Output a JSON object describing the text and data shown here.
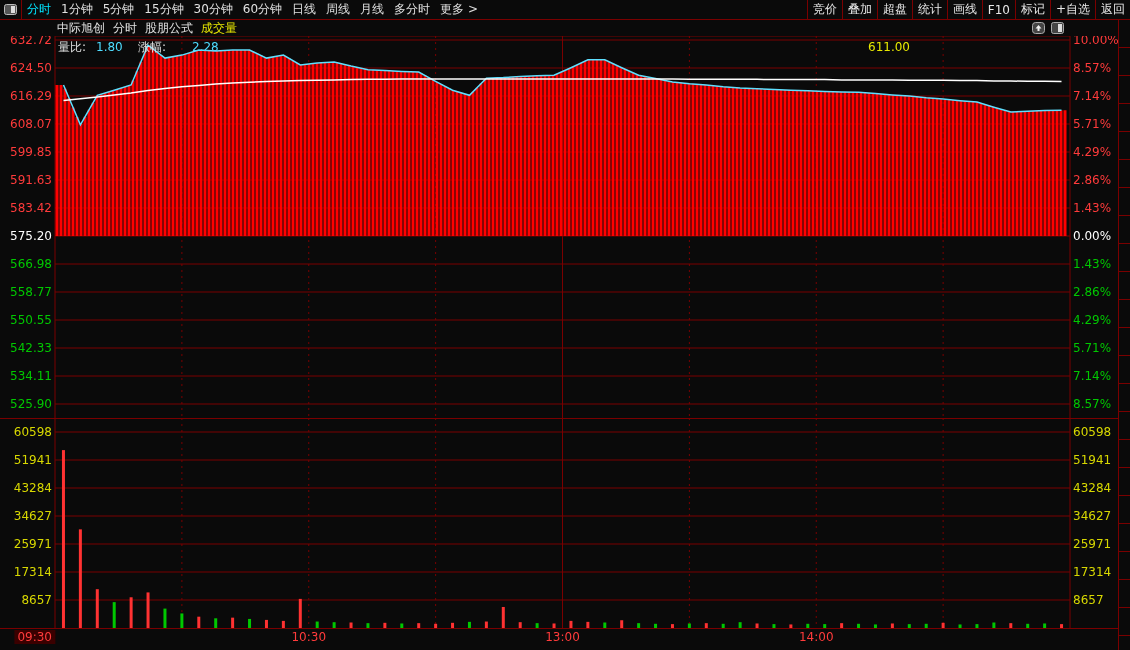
{
  "tabs": [
    {
      "label": "分时",
      "selected": true
    },
    {
      "label": "1分钟",
      "selected": false
    },
    {
      "label": "5分钟",
      "selected": false
    },
    {
      "label": "15分钟",
      "selected": false
    },
    {
      "label": "30分钟",
      "selected": false
    },
    {
      "label": "60分钟",
      "selected": false
    },
    {
      "label": "日线",
      "selected": false
    },
    {
      "label": "周线",
      "selected": false
    },
    {
      "label": "月线",
      "selected": false
    },
    {
      "label": "多分时",
      "selected": false
    },
    {
      "label": "更多 >",
      "selected": false
    }
  ],
  "toolbar_buttons": [
    "竞价",
    "叠加",
    "超盘",
    "统计",
    "画线",
    "F10",
    "标记",
    "+自选",
    "返回"
  ],
  "header": {
    "stock": "中际旭创",
    "mode": "分时",
    "formula": "股朋公式",
    "indicator": "成交量"
  },
  "info": {
    "ratio_label": "量比:",
    "ratio_value": "1.80",
    "change_label": "涨幅:",
    "change_value": "2.28",
    "marker_price": "611.00"
  },
  "price_chart": {
    "chart_data": {
      "type": "line",
      "grid": true,
      "ylim": [
        525.9,
        632.72
      ],
      "yticks": [
        {
          "value": 632.72,
          "label": "632.72"
        },
        {
          "value": 624.5,
          "label": "624.50"
        },
        {
          "value": 616.29,
          "label": "616.29"
        },
        {
          "value": 608.07,
          "label": "608.07"
        },
        {
          "value": 599.85,
          "label": "599.85"
        },
        {
          "value": 591.63,
          "label": "591.63"
        },
        {
          "value": 583.42,
          "label": "583.42"
        },
        {
          "value": 575.2,
          "label": "575.20"
        },
        {
          "value": 566.98,
          "label": "566.98"
        },
        {
          "value": 558.77,
          "label": "558.77"
        },
        {
          "value": 550.55,
          "label": "550.55"
        },
        {
          "value": 542.33,
          "label": "542.33"
        },
        {
          "value": 534.11,
          "label": "534.11"
        },
        {
          "value": 525.9,
          "label": "525.90"
        }
      ],
      "series": [
        {
          "color": "#5ee0ff",
          "values": [
            619.5,
            607.8,
            616.5,
            618.0,
            619.5,
            631.2,
            627.4,
            628.3,
            629.8,
            629.5,
            629.8,
            629.8,
            627.4,
            628.3,
            625.4,
            626.0,
            626.3,
            625.1,
            624.0,
            623.8,
            623.5,
            623.3,
            620.6,
            618.0,
            616.5,
            621.5,
            621.7,
            622.0,
            622.2,
            622.4,
            624.6,
            626.9,
            626.9,
            624.6,
            622.4,
            621.4,
            620.4,
            619.9,
            619.5,
            619.0,
            618.6,
            618.4,
            618.2,
            618.0,
            617.8,
            617.6,
            617.5,
            617.4,
            617.0,
            616.6,
            616.3,
            615.8,
            615.4,
            614.9,
            614.5,
            613.0,
            611.6,
            611.8,
            612.0,
            612.1
          ]
        },
        {
          "color": "#ffffff",
          "values": [
            615.0,
            615.5,
            616.0,
            616.6,
            617.2,
            617.9,
            618.5,
            619.0,
            619.4,
            619.8,
            620.1,
            620.3,
            620.5,
            620.7,
            620.8,
            620.9,
            621.0,
            621.1,
            621.2,
            621.2,
            621.3,
            621.3,
            621.3,
            621.3,
            621.3,
            621.3,
            621.3,
            621.3,
            621.3,
            621.3,
            621.3,
            621.3,
            621.3,
            621.3,
            621.3,
            621.3,
            621.3,
            621.2,
            621.2,
            621.2,
            621.2,
            621.2,
            621.1,
            621.1,
            621.1,
            621.1,
            621.0,
            621.0,
            621.0,
            621.0,
            620.9,
            620.9,
            620.9,
            620.8,
            620.8,
            620.7,
            620.7,
            620.6,
            620.6,
            620.5
          ]
        }
      ]
    },
    "right_axis": [
      {
        "text": "10.00%",
        "kind": "up"
      },
      {
        "text": "8.57%",
        "kind": "up"
      },
      {
        "text": "7.14%",
        "kind": "up"
      },
      {
        "text": "5.71%",
        "kind": "up"
      },
      {
        "text": "4.29%",
        "kind": "up"
      },
      {
        "text": "2.86%",
        "kind": "up"
      },
      {
        "text": "1.43%",
        "kind": "up"
      },
      {
        "text": "0.00%",
        "kind": "flat"
      },
      {
        "text": "1.43%",
        "kind": "down"
      },
      {
        "text": "2.86%",
        "kind": "down"
      },
      {
        "text": "4.29%",
        "kind": "down"
      },
      {
        "text": "5.71%",
        "kind": "down"
      },
      {
        "text": "7.14%",
        "kind": "down"
      },
      {
        "text": "8.57%",
        "kind": "down"
      }
    ]
  },
  "volume_chart": {
    "chart_data": {
      "type": "bar",
      "grid": true,
      "ylim": [
        0,
        60598
      ],
      "yticks": [
        {
          "value": 60598,
          "label": "60598"
        },
        {
          "value": 51941,
          "label": "51941"
        },
        {
          "value": 43284,
          "label": "43284"
        },
        {
          "value": 34627,
          "label": "34627"
        },
        {
          "value": 25971,
          "label": "25971"
        },
        {
          "value": 17314,
          "label": "17314"
        },
        {
          "value": 8657,
          "label": "8657"
        }
      ],
      "series": [
        {
          "color": "#ff3232",
          "values": [
            55000,
            30500,
            12000,
            null,
            9500,
            11000,
            null,
            null,
            3500,
            null,
            3200,
            null,
            2500,
            2200,
            9000,
            null,
            null,
            1700,
            null,
            1600,
            null,
            1500,
            1300,
            1600,
            null,
            2000,
            6500,
            1800,
            null,
            1400,
            2200,
            1900,
            null,
            2400,
            null,
            null,
            1200,
            null,
            1500,
            null,
            null,
            1400,
            null,
            1100,
            null,
            null,
            1500,
            null,
            null,
            1400,
            null,
            null,
            1600,
            null,
            null,
            null,
            1500,
            null,
            null,
            1200
          ]
        },
        {
          "color": "#00c800",
          "values": [
            null,
            null,
            null,
            8000,
            null,
            null,
            6000,
            4500,
            null,
            3000,
            null,
            2800,
            null,
            null,
            null,
            2000,
            1800,
            null,
            1500,
            null,
            1400,
            null,
            null,
            null,
            1900,
            null,
            null,
            null,
            1500,
            null,
            null,
            null,
            1700,
            null,
            1500,
            1300,
            null,
            1400,
            null,
            1300,
            1800,
            null,
            1200,
            null,
            1300,
            1200,
            null,
            1300,
            1100,
            null,
            1200,
            1300,
            null,
            1100,
            1200,
            1700,
            null,
            1300,
            1400,
            null
          ]
        }
      ]
    },
    "right_axis": [
      "60598",
      "51941",
      "43284",
      "34627",
      "25971",
      "17314",
      "8657"
    ]
  },
  "time_axis": [
    "09:30",
    "10:30",
    "13:00",
    "14:00"
  ]
}
